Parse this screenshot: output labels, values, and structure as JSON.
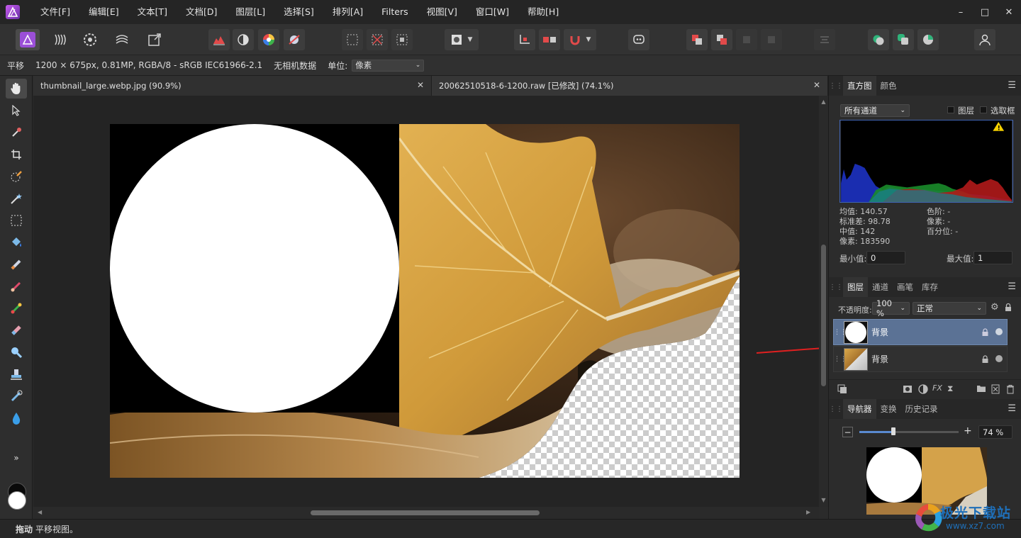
{
  "menubar": {
    "items": [
      "文件[F]",
      "编辑[E]",
      "文本[T]",
      "文档[D]",
      "图层[L]",
      "选择[S]",
      "排列[A]",
      "Filters",
      "视图[V]",
      "窗口[W]",
      "帮助[H]"
    ]
  },
  "context": {
    "tool_name": "平移",
    "doc_info": "1200 × 675px, 0.81MP, RGBA/8 - sRGB IEC61966-2.1",
    "camera": "无相机数据",
    "unit_label": "单位:",
    "unit_value": "像素"
  },
  "doc_tabs": [
    {
      "label": "thumbnail_large.webp.jpg (90.9%)"
    },
    {
      "label": "20062510518-6-1200.raw [已修改] (74.1%)"
    }
  ],
  "histogram_panel": {
    "tabs": [
      "直方图",
      "颜色"
    ],
    "channel": "所有通道",
    "opt_layer": "图层",
    "opt_selection": "选取框",
    "mean": "均值: 140.57",
    "stddev": "标准差: 98.78",
    "median": "中值: 142",
    "pixels": "像素: 183590",
    "levels": "色阶: -",
    "pixel_r": "像素: -",
    "percentile": "百分位: -",
    "min_label": "最小值:",
    "min_value": "0",
    "max_label": "最大值:",
    "max_value": "1"
  },
  "layers_panel": {
    "tabs": [
      "图层",
      "通道",
      "画笔",
      "库存"
    ],
    "opacity_label": "不透明度:",
    "opacity_value": "100 %",
    "blend_mode": "正常",
    "layers": [
      {
        "name": "背景",
        "selected": true
      },
      {
        "name": "背景",
        "selected": false
      }
    ]
  },
  "navigator_panel": {
    "tabs": [
      "导航器",
      "变换",
      "历史记录"
    ],
    "zoom_value": "74 %",
    "zoom_fraction": 0.34
  },
  "statusbar": {
    "bold": "拖动",
    "text": "平移视图。"
  },
  "watermark": {
    "text": "极光下载站",
    "url": "www.xz7.com"
  },
  "colors": {
    "accent_layer": "#5b7295",
    "arrow": "#e02020",
    "app_logo": "#8e44c9"
  }
}
